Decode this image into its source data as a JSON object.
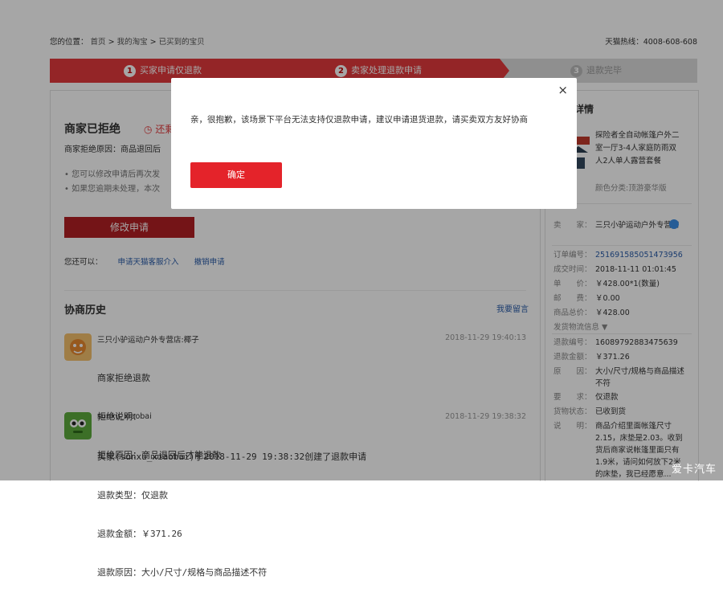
{
  "breadcrumb": {
    "prefix": "您的位置：",
    "items": [
      "首页",
      "我的淘宝",
      "已买到的宝贝"
    ],
    "sep": " > "
  },
  "hotline": "天猫热线：4008-608-608",
  "steps": [
    {
      "num": "1",
      "label": "买家申请仅退款"
    },
    {
      "num": "2",
      "label": "卖家处理退款申请"
    },
    {
      "num": "3",
      "label": "退款完毕"
    }
  ],
  "status": {
    "title": "商家已拒绝",
    "countdown": "还剩",
    "reason": "商家拒绝原因：商品退回后",
    "bullets": [
      "您可以修改申请后再次发",
      "如果您逾期未处理，本次"
    ],
    "modify_button": "修改申请",
    "also_label": "您还可以：",
    "also_links": [
      "申请天猫客服介入",
      "撤销申请"
    ]
  },
  "history": {
    "title": "协商历史",
    "more": "我要留言",
    "messages": [
      {
        "who": "三只小驴运动户外专营店:椰子",
        "time": "2018-11-29 19:40:13",
        "lines": [
          "商家拒绝退款",
          "拒绝说明：",
          "拒绝原因：商品退回后才能退款"
        ]
      },
      {
        "who": "sunxu_xiaobai",
        "time": "2018-11-29 19:38:32",
        "lines": [
          "买家(sunxu_xiaobai)于2018-11-29 19:38:32创建了退款申请",
          "退款类型：仅退款",
          "退款金额：￥371.26",
          "退款原因：大小/尺寸/规格与商品描述不符"
        ]
      }
    ]
  },
  "detail": {
    "title": "详情",
    "product_name": "探险者全自动帐篷户外二室一厅3-4人家庭防雨双人2人单人露营套餐",
    "product_spec": "颜色分类:顶游豪华版",
    "seller_label": "卖　　家：",
    "seller": "三只小驴运动户外专营店",
    "rows": [
      {
        "k": "订单编号：",
        "v": "251691585051473956",
        "link": true
      },
      {
        "k": "成交时间：",
        "v": "2018-11-11 01:01:45"
      },
      {
        "k": "单　　价：",
        "v": "￥428.00*1(数量)"
      },
      {
        "k": "邮　　费：",
        "v": "￥0.00"
      },
      {
        "k": "商品总价：",
        "v": "￥428.00"
      }
    ],
    "logistics": "发货物流信息 ▼",
    "rows2": [
      {
        "k": "退款编号：",
        "v": "16089792883475639"
      },
      {
        "k": "退款金额：",
        "v": "￥371.26"
      },
      {
        "k": "原　　因：",
        "v": "大小/尺寸/规格与商品描述不符"
      },
      {
        "k": "要　　求：",
        "v": "仅退款"
      },
      {
        "k": "货物状态：",
        "v": "已收到货"
      },
      {
        "k": "说　　明：",
        "v": "商品介绍里面帐篷尺寸2.15，床垫是2.03。收到货后商家说帐篷里面只有1.9米，请问如何放下2米的床垫，我已经愿意..."
      }
    ]
  },
  "modal": {
    "message": "亲，很抱歉，该场景下平台无法支持仅退款申请，建议申请退货退款，请买卖双方友好协商",
    "ok": "确定",
    "close": "×"
  },
  "watermark": "爱卡汽车",
  "colors": {
    "brand_red": "#e4393c",
    "modal_button": "#e4232a",
    "link": "#2a5caa"
  }
}
